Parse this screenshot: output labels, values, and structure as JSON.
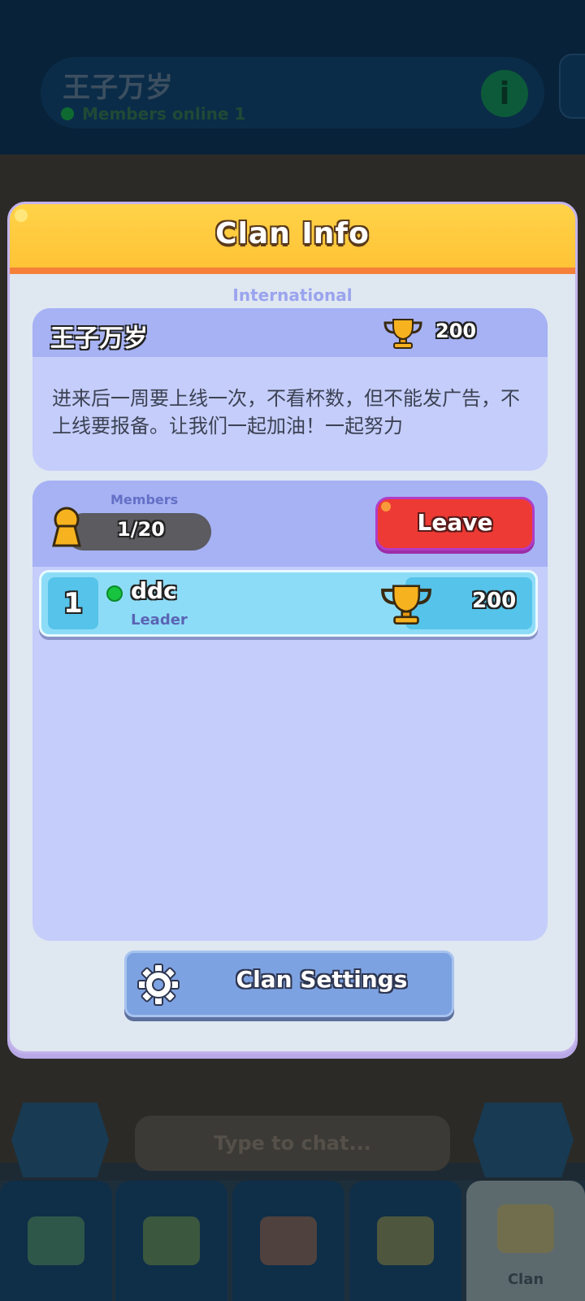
{
  "background": {
    "clan_name": "王子万岁",
    "members_online": "Members online 1",
    "chat_placeholder": "Type to chat...",
    "nav_active_label": "Clan"
  },
  "modal": {
    "title": "Clan Info",
    "region": "International",
    "clan": {
      "name": "王子万岁",
      "trophies": "200",
      "description": "进来后一周要上线一次，不看杯数，但不能发广告，不上线要报备。让我们一起加油！一起努力"
    },
    "members": {
      "label": "Members",
      "count": "1/20",
      "leave_label": "Leave",
      "list": [
        {
          "rank": "1",
          "name": "ddc",
          "role": "Leader",
          "trophies": "200",
          "online": true
        }
      ]
    },
    "settings_label": "Clan Settings"
  },
  "colors": {
    "header_yellow": "#ffc336",
    "header_border_orange": "#f4803a",
    "panel_lavender": "#c5cdfb",
    "leave_red": "#ee3a34",
    "member_row_cyan": "#8ddcf7",
    "online_green": "#17c33f"
  }
}
